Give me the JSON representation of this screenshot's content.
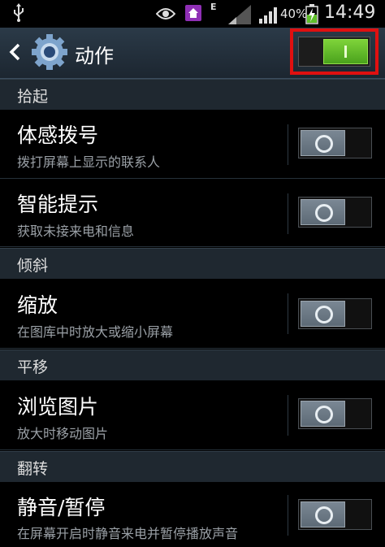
{
  "status_bar": {
    "battery_percent": "40%",
    "time": "14:49",
    "network_type": "E",
    "icons": [
      "usb-icon",
      "eye-icon",
      "home-icon",
      "signal-icon",
      "battery-charging-icon"
    ]
  },
  "action_bar": {
    "title": "动作",
    "master_switch": "on"
  },
  "sections": [
    {
      "header": "拾起",
      "items": [
        {
          "title": "体感拨号",
          "subtitle": "拨打屏幕上显示的联系人",
          "enabled": false
        },
        {
          "title": "智能提示",
          "subtitle": "获取未接来电和信息",
          "enabled": false
        }
      ]
    },
    {
      "header": "倾斜",
      "items": [
        {
          "title": "缩放",
          "subtitle": "在图库中时放大或缩小屏幕",
          "enabled": false
        }
      ]
    },
    {
      "header": "平移",
      "items": [
        {
          "title": "浏览图片",
          "subtitle": "放大时移动图片",
          "enabled": false
        }
      ]
    },
    {
      "header": "翻转",
      "items": [
        {
          "title": "静音/暂停",
          "subtitle": "在屏幕开启时静音来电并暂停播放声音",
          "enabled": false
        }
      ]
    }
  ],
  "colors": {
    "accent_green": "#5fbf2a",
    "highlight_red": "#e01010",
    "header_bg": "#1f2830"
  }
}
